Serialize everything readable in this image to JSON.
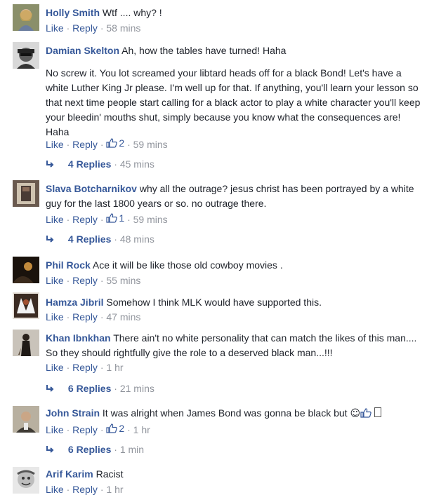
{
  "comments": [
    {
      "name": "Holly Smith",
      "text": "Wtf .... why? !",
      "like": "Like",
      "reply": "Reply",
      "time": "58 mins",
      "likes": "",
      "replies": "",
      "replies_time": ""
    },
    {
      "name": "Damian Skelton",
      "text": "Ah, how the tables have turned! Haha",
      "text2": "No screw it. You lot screamed your libtard heads off for a black Bond! Let's have a white Luther King Jr please. I'm well up for that. If anything, you'll learn your lesson so that next time people start calling for a black actor to play a white character you'll keep your bleedin' mouths shut, simply because you know what the consequences are! Haha",
      "like": "Like",
      "reply": "Reply",
      "time": "59 mins",
      "likes": "2",
      "replies": "4 Replies",
      "replies_time": "45 mins"
    },
    {
      "name": "Slava Botcharnikov",
      "text": "why all the outrage? jesus christ has been portrayed by a white guy for the last 1800 years or so. no outrage there.",
      "like": "Like",
      "reply": "Reply",
      "time": "59 mins",
      "likes": "1",
      "replies": "4 Replies",
      "replies_time": "48 mins"
    },
    {
      "name": "Phil Rock",
      "text": "Ace it will be like those old cowboy movies .",
      "like": "Like",
      "reply": "Reply",
      "time": "55 mins"
    },
    {
      "name": "Hamza Jibril",
      "text": "Somehow I think MLK would have supported this.",
      "like": "Like",
      "reply": "Reply",
      "time": "47 mins"
    },
    {
      "name": "Khan Ibnkhan",
      "text": "There ain't no white personality that can match the likes of this man.... So they should rightfully give the role to a deserved black man...!!!",
      "like": "Like",
      "reply": "Reply",
      "time": "1 hr",
      "replies": "6 Replies",
      "replies_time": "21 mins"
    },
    {
      "name": "John Strain",
      "text": "It was alright when James Bond was gonna be black but",
      "like": "Like",
      "reply": "Reply",
      "time": "1 hr",
      "likes": "2",
      "replies": "6 Replies",
      "replies_time": "1 min"
    },
    {
      "name": "Arif Karim",
      "text": "Racist",
      "like": "Like",
      "reply": "Reply",
      "time": "1 hr"
    }
  ],
  "icons": {
    "like": "thumbs-up-icon",
    "reply_arrow": "reply-arrow-icon"
  },
  "colors": {
    "link": "#365899",
    "meta": "#90949c",
    "text": "#1d2129"
  }
}
